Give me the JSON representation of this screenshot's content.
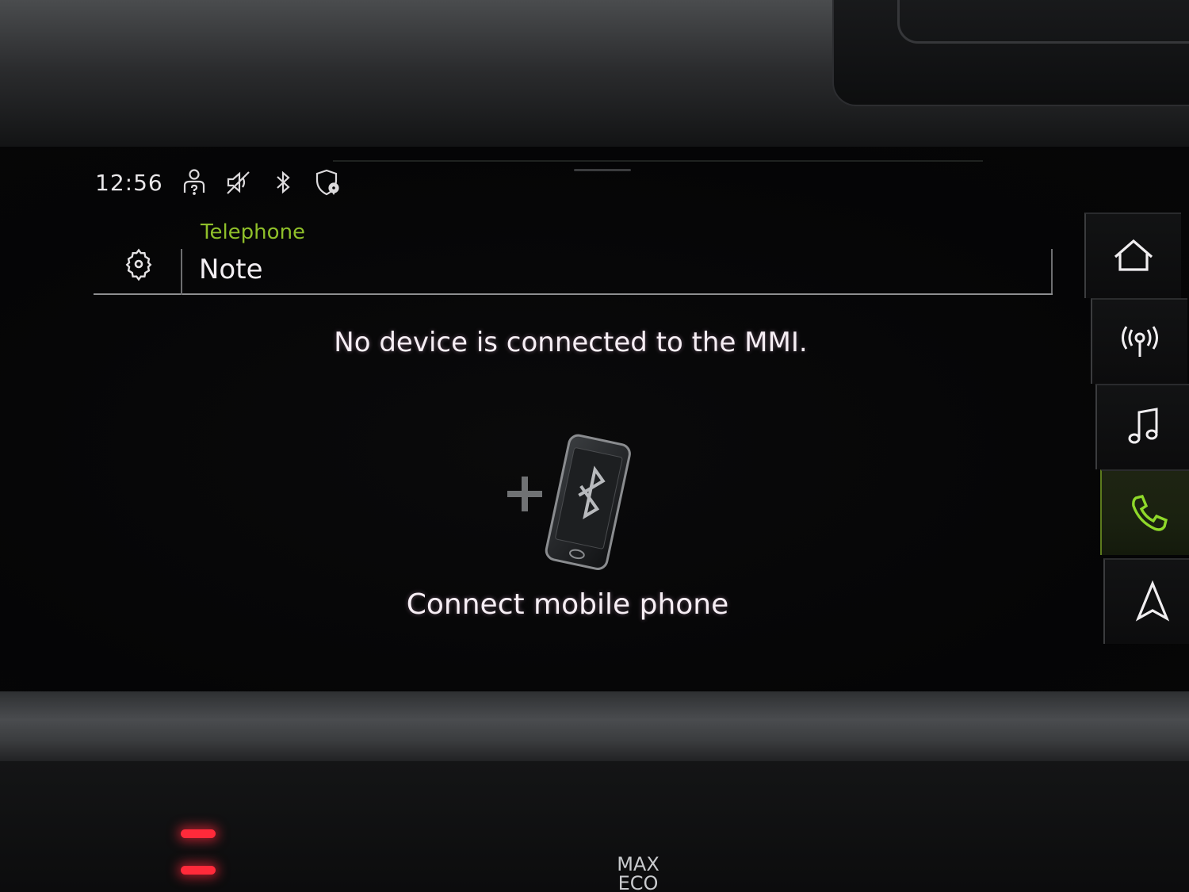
{
  "status_bar": {
    "time": "12:56",
    "icons": [
      "passenger-user-icon",
      "mute-icon",
      "bluetooth-icon",
      "location-shield-icon"
    ]
  },
  "header": {
    "breadcrumb": "Telephone",
    "title": "Note",
    "settings_icon": "gear-icon"
  },
  "main": {
    "message": "No device is connected to the MMI.",
    "connect_label": "Connect mobile phone",
    "illustration": "add-bluetooth-phone-icon"
  },
  "nav": {
    "items": [
      {
        "id": "home",
        "icon": "home-icon",
        "active": false
      },
      {
        "id": "radio",
        "icon": "radio-icon",
        "active": false
      },
      {
        "id": "media",
        "icon": "music-icon",
        "active": false
      },
      {
        "id": "phone",
        "icon": "phone-icon",
        "active": true
      },
      {
        "id": "navigation",
        "icon": "navigation-icon",
        "active": false
      }
    ]
  },
  "climate": {
    "button_label_line1": "MAX",
    "button_label_line2": "ECO"
  },
  "colors": {
    "accent": "#8fbf2a",
    "text": "#f2eef2",
    "background": "#050506",
    "led": "#ff2a3a"
  }
}
